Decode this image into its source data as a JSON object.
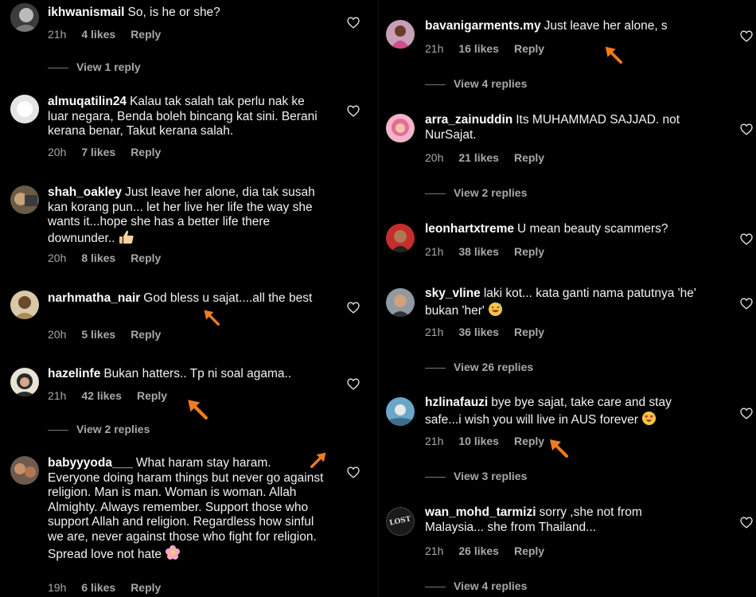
{
  "left": [
    {
      "username": "ikhwanismail",
      "text": "So, is he or she?",
      "time": "21h",
      "likes": "4 likes",
      "reply": "Reply",
      "view": "View 1 reply"
    },
    {
      "username": "almuqatilin24",
      "text": "Kalau tak salah tak perlu nak ke luar negara, Benda boleh bincang kat sini. Berani kerana benar, Takut kerana salah.",
      "time": "20h",
      "likes": "7 likes",
      "reply": "Reply"
    },
    {
      "username": "shah_oakley",
      "text": "Just leave her alone, dia tak susah kan korang pun... let her live her life the way she wants it...hope she has a better life there downunder..",
      "time": "20h",
      "likes": "8 likes",
      "reply": "Reply"
    },
    {
      "username": "narhmatha_nair",
      "text": "God bless u sajat....all the best",
      "time": "20h",
      "likes": "5 likes",
      "reply": "Reply"
    },
    {
      "username": "hazelinfe",
      "text": "Bukan hatters.. Tp ni soal agama..",
      "time": "21h",
      "likes": "42 likes",
      "reply": "Reply",
      "view": "View 2 replies"
    },
    {
      "username": "babyyyoda___",
      "text": "What haram stay haram. Everyone doing haram things but never go against religion. Man is man. Woman is woman. Allah Almighty. Always remember. Support those who support Allah and religion. Regardless how sinful we are, never against those who fight for religion. Spread love not hate",
      "time": "19h",
      "likes": "6 likes",
      "reply": "Reply"
    }
  ],
  "right": [
    {
      "username": "bavanigarments.my",
      "text": "Just leave her alone, s",
      "time": "21h",
      "likes": "16 likes",
      "reply": "Reply",
      "view": "View 4 replies"
    },
    {
      "username": "arra_zainuddin",
      "text": "Its MUHAMMAD SAJJAD. not NurSajat.",
      "time": "20h",
      "likes": "21 likes",
      "reply": "Reply",
      "view": "View 2 replies"
    },
    {
      "username": "leonhartxtreme",
      "text": "U mean beauty scammers?",
      "time": "21h",
      "likes": "38 likes",
      "reply": "Reply"
    },
    {
      "username": "sky_vline",
      "text": "laki kot... kata ganti nama patutnya 'he' bukan 'her'",
      "time": "21h",
      "likes": "36 likes",
      "reply": "Reply",
      "view": "View 26 replies"
    },
    {
      "username": "hzlinafauzi",
      "text": "bye bye sajat, take care and stay safe...i wish you will live in AUS forever",
      "time": "21h",
      "likes": "10 likes",
      "reply": "Reply",
      "view": "View 3 replies"
    },
    {
      "username": "wan_mohd_tarmizi",
      "text": "sorry ,she not from Malaysia... she from Thailand...",
      "time": "21h",
      "likes": "26 likes",
      "reply": "Reply",
      "view": "View 4 replies"
    }
  ],
  "avatar_lost_text": "LOST",
  "colors": {
    "background": "#000000",
    "text": "#f5f5f5",
    "meta": "#a8a8a8",
    "arrow": "#f07c1d"
  }
}
